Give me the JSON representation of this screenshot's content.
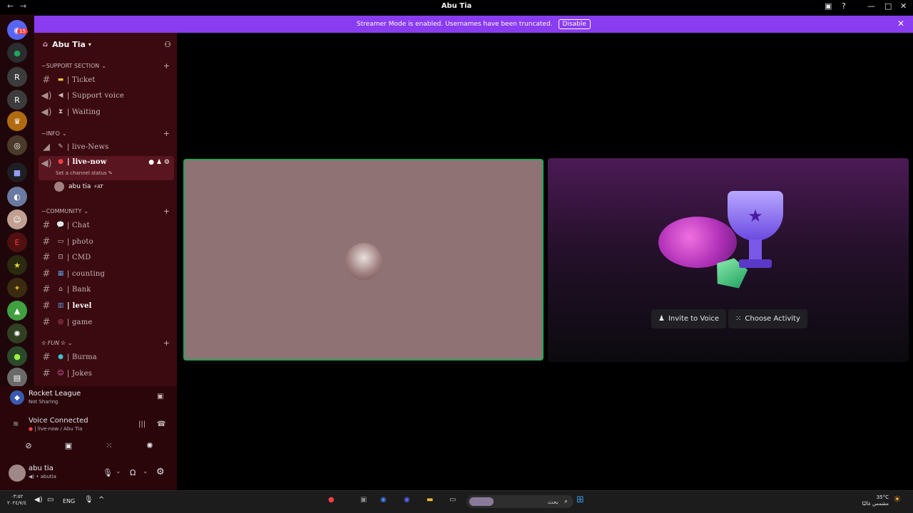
{
  "window": {
    "title": "Abu Tia"
  },
  "banner": {
    "text": "Streamer Mode is enabled. Usernames have been truncated.",
    "button": "Disable"
  },
  "server": {
    "name": "Abu Tia"
  },
  "guild_badge": "15",
  "categories": {
    "support": "SUPPORT SECTION",
    "info": "INFO",
    "community": "COMMUNITY",
    "fun": "FUN"
  },
  "channels": {
    "ticket": "| Ticket",
    "support_voice": "| Support voice",
    "waiting": "| Waiting",
    "live_news": "| live-News",
    "live_now": "| live-now",
    "channel_status": "Set a channel status",
    "voice_user": "abu tia",
    "voice_user_tag": "AT",
    "chat": "| Chat",
    "photo": "| photo",
    "cmd": "| CMD",
    "counting": "| counting",
    "bank": "| Bank",
    "level": "| level",
    "game": "| game",
    "burma": "| Burma",
    "jokes": "| Jokes"
  },
  "activity": {
    "name": "Rocket League",
    "status": "Not Sharing"
  },
  "voice": {
    "status": "Voice Connected",
    "location": "| live-now / Abu Tia"
  },
  "user": {
    "name": "abu tia",
    "handle": "abutia"
  },
  "stage": {
    "invite": "Invite to Voice",
    "activity": "Choose Activity"
  },
  "taskbar": {
    "lang": "ENG",
    "time": "٠٣:٥٢",
    "date": "٢٠٢٤/٧/٤",
    "search": "بحث",
    "temp": "35°C",
    "weather": "مشمس غالبًا"
  },
  "colors": {
    "accent": "#8a3cf0",
    "sidebar": "#3a0a10",
    "speaking": "#23a559"
  }
}
